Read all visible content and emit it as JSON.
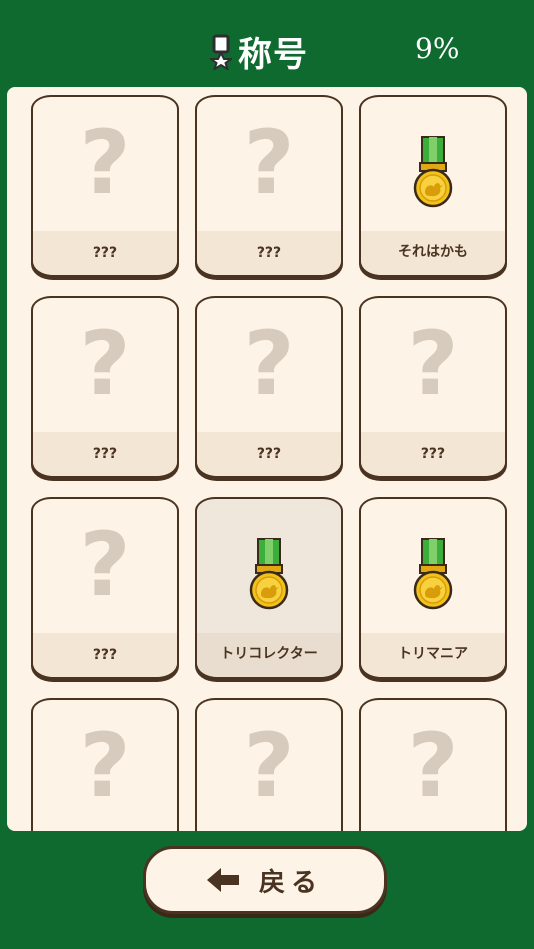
{
  "header": {
    "title": "称号",
    "progress": "9%",
    "icon": "medal-badge-icon"
  },
  "colors": {
    "background": "#0f6a30",
    "panel": "#fdf3e6",
    "card_border": "#4a3320",
    "locked_mark": "#d6cbbd",
    "ribbon": "#3cae3c",
    "medal_gold": "#f2c21a"
  },
  "titles": [
    {
      "label": "???",
      "unlocked": false
    },
    {
      "label": "???",
      "unlocked": false
    },
    {
      "label": "それはかも",
      "unlocked": true
    },
    {
      "label": "???",
      "unlocked": false
    },
    {
      "label": "???",
      "unlocked": false
    },
    {
      "label": "???",
      "unlocked": false
    },
    {
      "label": "???",
      "unlocked": false
    },
    {
      "label": "トリコレクター",
      "unlocked": true,
      "selected": true
    },
    {
      "label": "トリマニア",
      "unlocked": true
    },
    {
      "label": "",
      "unlocked": false
    },
    {
      "label": "",
      "unlocked": false
    },
    {
      "label": "",
      "unlocked": false
    }
  ],
  "locked_symbol": "?",
  "footer": {
    "back_label": "戻る",
    "back_icon": "arrow-left-icon"
  }
}
